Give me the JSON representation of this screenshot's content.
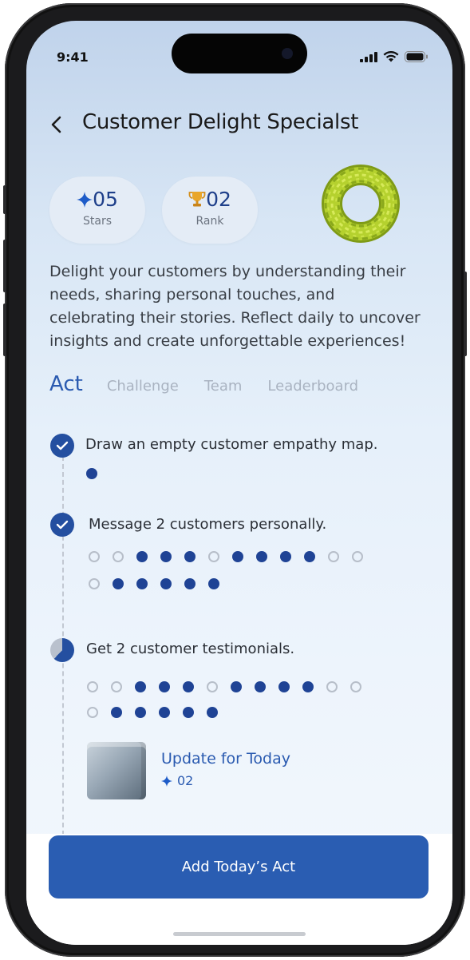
{
  "status_bar": {
    "time": "9:41"
  },
  "header": {
    "title": "Customer Delight Specialst"
  },
  "stats": [
    {
      "value": "05",
      "label": "Stars",
      "icon": "sparkle-icon"
    },
    {
      "value": "02",
      "label": "Rank",
      "icon": "trophy-icon"
    }
  ],
  "description": "Delight your customers by understanding their needs, sharing personal touches, and celebrating their stories. Reflect daily to uncover insights and create unforgettable experiences!",
  "tabs": [
    "Act",
    "Challenge",
    "Team",
    "Leaderboard"
  ],
  "active_tab": "Act",
  "tasks": [
    {
      "title": "Draw an empty customer empathy map.",
      "status": "done",
      "rows": [
        [
          1
        ]
      ]
    },
    {
      "title": "Message 2 customers personally.",
      "status": "done",
      "rows": [
        [
          0,
          0,
          1,
          1,
          1,
          0,
          1,
          1,
          1,
          1,
          0,
          0
        ],
        [
          0,
          1,
          1,
          1,
          1,
          1
        ]
      ]
    },
    {
      "title": "Get 2 customer testimonials.",
      "status": "in-progress",
      "rows": [
        [
          0,
          0,
          1,
          1,
          1,
          0,
          1,
          1,
          1,
          1,
          0,
          0
        ],
        [
          0,
          1,
          1,
          1,
          1,
          1
        ]
      ]
    }
  ],
  "update": {
    "title": "Update for Today",
    "count": "02"
  },
  "cta": {
    "label": "Add Today’s Act"
  },
  "colors": {
    "accent": "#2a5db2",
    "filled_dot": "#1f4395",
    "torus": "#a9c526"
  }
}
